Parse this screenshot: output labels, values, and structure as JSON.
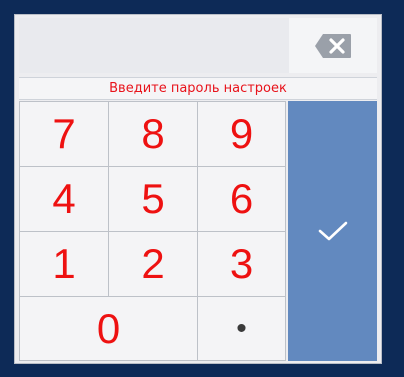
{
  "prompt": "Введите пароль настроек",
  "password": {
    "value": "",
    "placeholder": ""
  },
  "keys": {
    "k7": "7",
    "k8": "8",
    "k9": "9",
    "k4": "4",
    "k5": "5",
    "k6": "6",
    "k1": "1",
    "k2": "2",
    "k3": "3",
    "k0": "0",
    "dot": "•"
  },
  "icons": {
    "backspace": "backspace-icon",
    "confirm": "checkmark-icon"
  },
  "colors": {
    "background": "#0d2a57",
    "digit": "#ee1111",
    "prompt": "#e8131b",
    "confirm": "#6289bf",
    "backspace_icon": "#9aa0a9"
  }
}
